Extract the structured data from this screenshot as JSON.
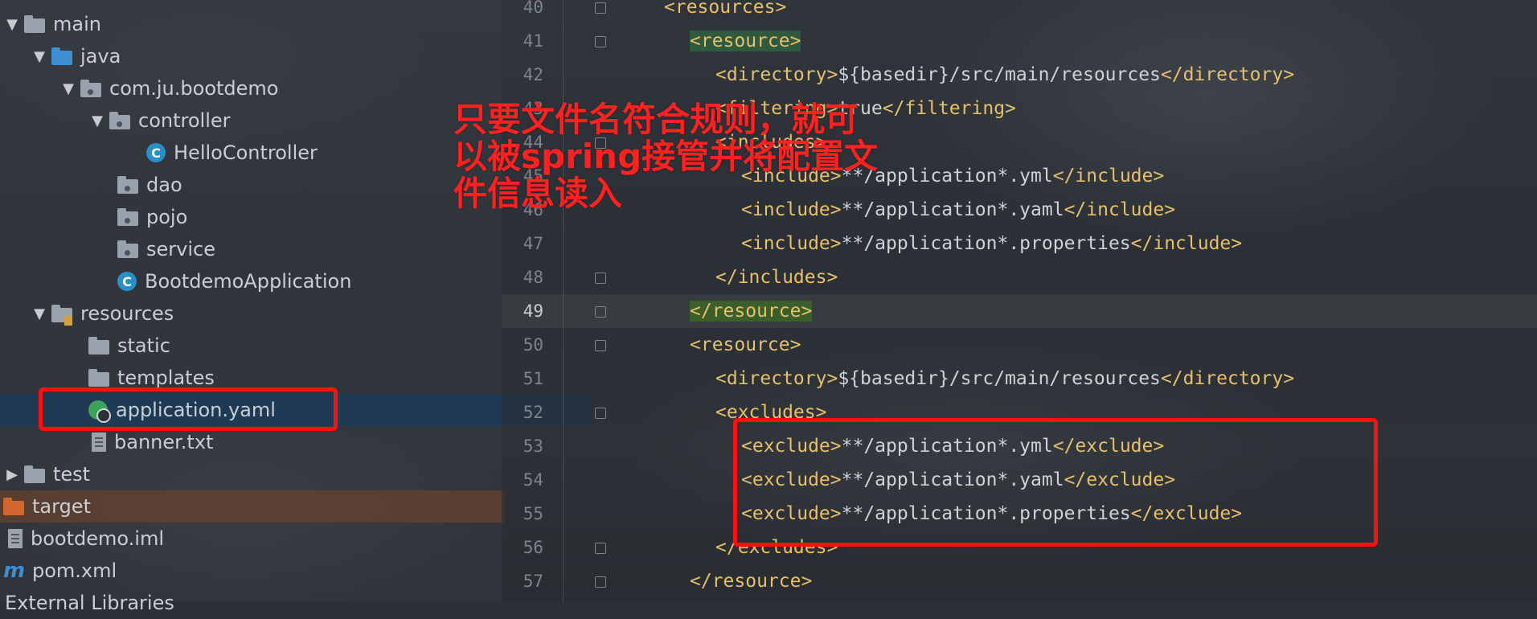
{
  "tree": {
    "items": [
      {
        "label": "main"
      },
      {
        "label": "java"
      },
      {
        "label": "com.ju.bootdemo"
      },
      {
        "label": "controller"
      },
      {
        "label": "HelloController"
      },
      {
        "label": "dao"
      },
      {
        "label": "pojo"
      },
      {
        "label": "service"
      },
      {
        "label": "BootdemoApplication"
      },
      {
        "label": "resources"
      },
      {
        "label": "static"
      },
      {
        "label": "templates"
      },
      {
        "label": "application.yaml"
      },
      {
        "label": "banner.txt"
      },
      {
        "label": "test"
      },
      {
        "label": "target"
      },
      {
        "label": "bootdemo.iml"
      },
      {
        "label": "pom.xml"
      },
      {
        "label": "External Libraries"
      }
    ],
    "selected": "application.yaml"
  },
  "editor": {
    "current_line": "49",
    "lines": [
      {
        "num": "40",
        "parts": [
          "<resources>"
        ]
      },
      {
        "num": "41",
        "parts": [
          "<resource>"
        ]
      },
      {
        "num": "42",
        "parts": [
          "<directory>",
          "${basedir}/src/main/resources",
          "</directory>"
        ]
      },
      {
        "num": "43",
        "parts": [
          "<filtering>",
          "true",
          "</filtering>"
        ]
      },
      {
        "num": "44",
        "parts": [
          "<includes>"
        ]
      },
      {
        "num": "45",
        "parts": [
          "<include>",
          "**/application*.yml",
          "</include>"
        ]
      },
      {
        "num": "46",
        "parts": [
          "<include>",
          "**/application*.yaml",
          "</include>"
        ]
      },
      {
        "num": "47",
        "parts": [
          "<include>",
          "**/application*.properties",
          "</include>"
        ]
      },
      {
        "num": "48",
        "parts": [
          "</includes>"
        ]
      },
      {
        "num": "49",
        "parts": [
          "</resource>"
        ]
      },
      {
        "num": "50",
        "parts": [
          "<resource>"
        ]
      },
      {
        "num": "51",
        "parts": [
          "<directory>",
          "${basedir}/src/main/resources",
          "</directory>"
        ]
      },
      {
        "num": "52",
        "parts": [
          "<excludes>"
        ]
      },
      {
        "num": "53",
        "parts": [
          "<exclude>",
          "**/application*.yml",
          "</exclude>"
        ]
      },
      {
        "num": "54",
        "parts": [
          "<exclude>",
          "**/application*.yaml",
          "</exclude>"
        ]
      },
      {
        "num": "55",
        "parts": [
          "<exclude>",
          "**/application*.properties",
          "</exclude>"
        ]
      },
      {
        "num": "56",
        "parts": [
          "</excludes>"
        ]
      },
      {
        "num": "57",
        "parts": [
          "</resource>"
        ]
      }
    ]
  },
  "annotation": {
    "lines": [
      "只要文件名符合规则，就可",
      "以被spring接管并将配置文",
      "件信息读入"
    ],
    "color": "#ff1010"
  }
}
